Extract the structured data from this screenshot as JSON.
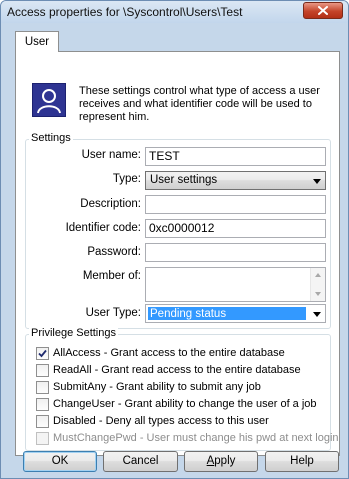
{
  "window": {
    "title": "Access properties for \\Syscontrol\\Users\\Test"
  },
  "tabs": [
    {
      "label": "User"
    }
  ],
  "info_text": "These settings control what type of access a user receives and what identifier code will be used to represent him.",
  "settings": {
    "legend": "Settings",
    "user_name": {
      "label": "User name:",
      "value": "TEST"
    },
    "type": {
      "label": "Type:",
      "value": "User settings"
    },
    "description": {
      "label": "Description:",
      "value": ""
    },
    "identifier_code": {
      "label": "Identifier code:",
      "value": "0xc0000012"
    },
    "password": {
      "label": "Password:",
      "value": ""
    },
    "member_of": {
      "label": "Member of:"
    },
    "user_type": {
      "label": "User Type:",
      "value": "Pending status"
    }
  },
  "privileges": {
    "legend": "Privilege Settings",
    "items": [
      {
        "label": "AllAccess - Grant access to the entire database",
        "checked": true,
        "enabled": true
      },
      {
        "label": "ReadAll - Grant read access to the entire database",
        "checked": false,
        "enabled": true
      },
      {
        "label": "SubmitAny - Grant ability to submit any job",
        "checked": false,
        "enabled": true
      },
      {
        "label": "ChangeUser - Grant ability to change the user of a job",
        "checked": false,
        "enabled": true
      },
      {
        "label": "Disabled - Deny all types access to this user",
        "checked": false,
        "enabled": true
      },
      {
        "label": "MustChangePwd - User must change his pwd at next login",
        "checked": false,
        "enabled": false
      }
    ]
  },
  "buttons": {
    "ok": "OK",
    "cancel": "Cancel",
    "apply_first": "A",
    "apply_rest": "pply",
    "help": "Help"
  },
  "colors": {
    "selection": "#3399ff",
    "frame": "#c5d7ea",
    "close": "#c4442a",
    "user_icon_bg": "#2e3492"
  },
  "icons": {
    "close": "close-icon",
    "user": "user-icon",
    "combo_arrow": "chevron-down-icon",
    "check": "check-icon"
  }
}
